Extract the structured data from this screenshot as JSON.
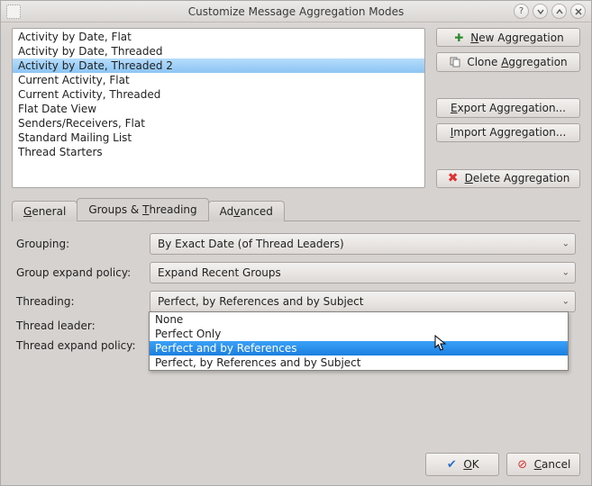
{
  "window": {
    "title": "Customize Message Aggregation Modes"
  },
  "list": {
    "items": [
      "Activity by Date, Flat",
      "Activity by Date, Threaded",
      "Activity by Date, Threaded 2",
      "Current Activity, Flat",
      "Current Activity, Threaded",
      "Flat Date View",
      "Senders/Receivers, Flat",
      "Standard Mailing List",
      "Thread Starters"
    ],
    "selected_index": 2
  },
  "buttons": {
    "new": {
      "pre": "",
      "u": "N",
      "post": "ew Aggregation"
    },
    "clone": {
      "pre": "Clone ",
      "u": "A",
      "post": "ggregation"
    },
    "export": {
      "pre": "",
      "u": "E",
      "post": "xport Aggregation..."
    },
    "import": {
      "pre": "",
      "u": "I",
      "post": "mport Aggregation..."
    },
    "delete": {
      "pre": "",
      "u": "D",
      "post": "elete Aggregation"
    },
    "ok": {
      "u": "O",
      "post": "K"
    },
    "cancel": {
      "u": "C",
      "post": "ancel"
    }
  },
  "tabs": {
    "general": {
      "u": "G",
      "post": "eneral"
    },
    "groups": {
      "pre": "Groups && ",
      "u": "T",
      "post": "hreading"
    },
    "advanced": {
      "pre": "Ad",
      "u": "v",
      "post": "anced"
    },
    "active": "groups"
  },
  "form": {
    "grouping_label": "Grouping:",
    "grouping_value": "By Exact Date (of Thread Leaders)",
    "group_expand_label": "Group expand policy:",
    "group_expand_value": "Expand Recent Groups",
    "threading_label": "Threading:",
    "threading_value": "Perfect, by References and by Subject",
    "thread_leader_label": "Thread leader:",
    "thread_expand_label": "Thread expand policy:"
  },
  "threading_dropdown": {
    "options": [
      "None",
      "Perfect Only",
      "Perfect and by References",
      "Perfect, by References and by Subject"
    ],
    "highlight_index": 2
  }
}
